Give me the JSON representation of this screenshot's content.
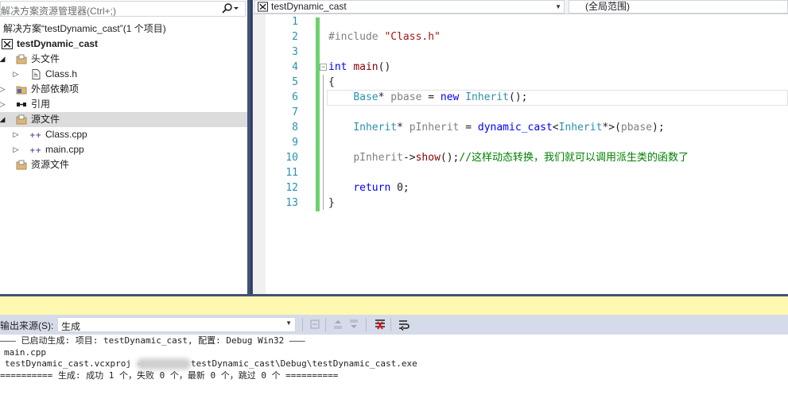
{
  "solution_explorer": {
    "search_placeholder": "解决方案资源管理器(Ctrl+;)",
    "solution_label": "解决方案“testDynamic_cast”(1 个项目)",
    "project": "testDynamic_cast",
    "items": [
      {
        "label": "头文件"
      },
      {
        "label": "Class.h"
      },
      {
        "label": "外部依赖项"
      },
      {
        "label": "引用"
      },
      {
        "label": "源文件"
      },
      {
        "label": "Class.cpp"
      },
      {
        "label": "main.cpp"
      },
      {
        "label": "资源文件"
      }
    ]
  },
  "editor": {
    "nav_left": "testDynamic_cast",
    "nav_right": "(全局范围)",
    "line_numbers": [
      "1",
      "2",
      "3",
      "4",
      "5",
      "6",
      "7",
      "8",
      "9",
      "10",
      "11",
      "12",
      "13"
    ],
    "code": {
      "l2_directive": "#include",
      "l2_string": "\"Class.h\"",
      "l4_kw": "int",
      "l4_fn": "main",
      "l4_rest": "()",
      "l5": "{",
      "l6_type": "Base",
      "l6_star": "*",
      "l6_var": "pbase",
      "l6_eq": " = ",
      "l6_new": "new",
      "l6_type2": "Inherit",
      "l6_rest": "();",
      "l8_type": "Inherit",
      "l8_star": "*",
      "l8_var": "pInherit",
      "l8_eq": " = ",
      "l8_kw": "dynamic_cast",
      "l8_lt": "<",
      "l8_type2": "Inherit",
      "l8_gt": "*>(",
      "l8_arg": "pbase",
      "l8_rest": ");",
      "l10_var": "pInherit",
      "l10_arrow": "->",
      "l10_fn": "show",
      "l10_rest": "();",
      "l10_comment": "//这样动态转换，我们就可以调用派生类的函数了",
      "l12_kw": "return",
      "l12_rest": " 0;",
      "l13": "}"
    }
  },
  "output": {
    "source_label": "输出来源(S):",
    "source_value": "生成",
    "lines": [
      "——— 已启动生成: 项目: testDynamic_cast, 配置: Debug Win32 ———",
      "main.cpp",
      "testDynamic_cast.vcxproj ->",
      "testDynamic_cast\\Debug\\testDynamic_cast.exe",
      "========== 生成: 成功 1 个，失败 0 个，最新 0 个，跳过 0 个 =========="
    ]
  },
  "colors": {
    "accent": "#42527a",
    "change_bar": "#6cd26c",
    "output_title": "#fff8b0",
    "line_number": "#2b91af",
    "keyword": "#0000ff",
    "comment": "#008000"
  }
}
